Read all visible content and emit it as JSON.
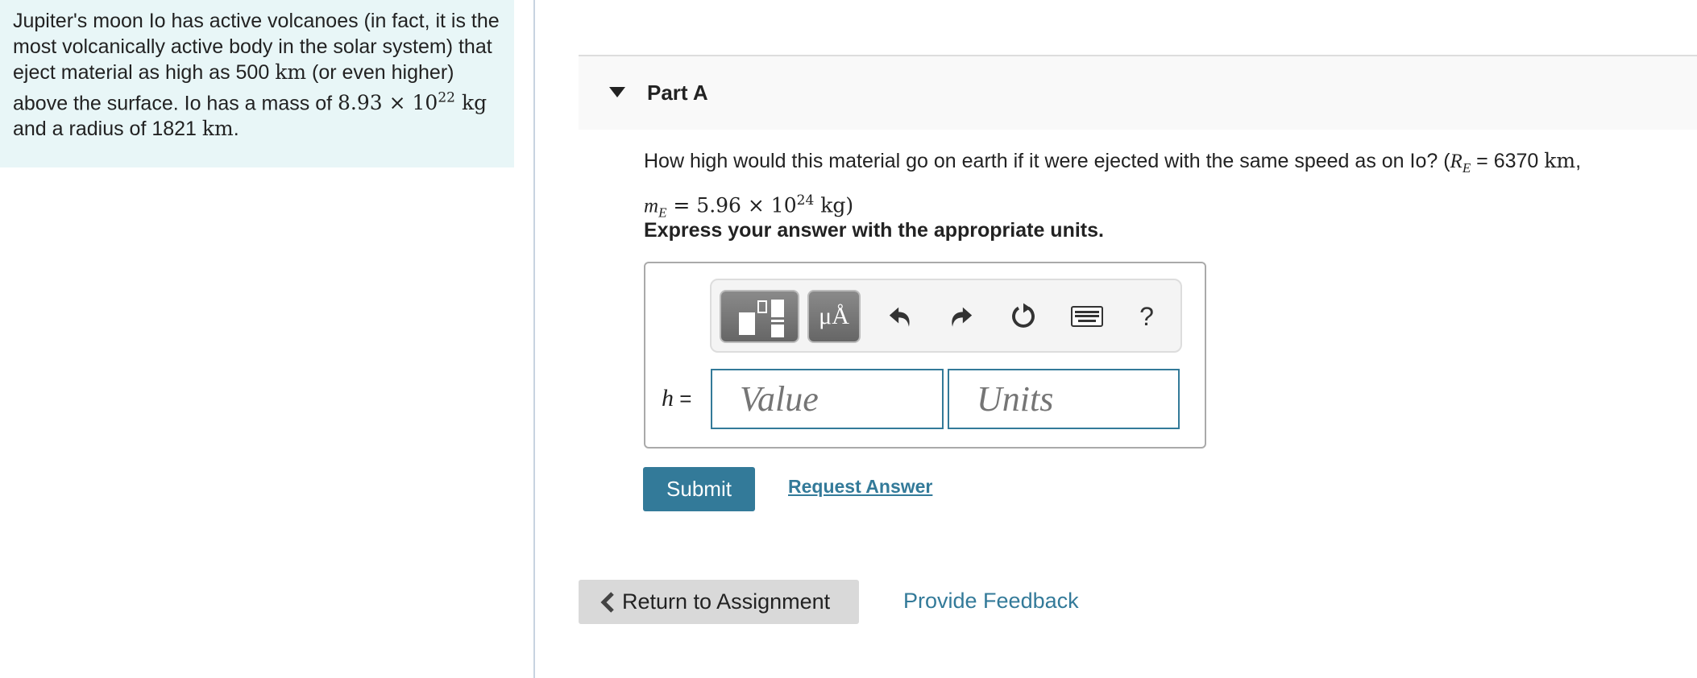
{
  "intro": {
    "text_1": "Jupiter's moon Io has active volcanoes (in fact, it is the most volcanically active body in the solar system) that eject material as high as 500 ",
    "unit_km": "km",
    "text_2": " (or even higher) above the surface. Io has a mass of ",
    "mass_mantissa": "8.93 × 10",
    "mass_exp": "22",
    "unit_kg": "kg",
    "text_3": " and a radius of 1821 ",
    "unit_km2": "km",
    "text_4": "."
  },
  "part": {
    "title": "Part A",
    "question_text": "How high would this material go on earth if it were ejected with the same speed as on Io? (",
    "re_symbol": "R",
    "re_sub": "E",
    "re_value": " = 6370 ",
    "re_unit": "km",
    "comma": ",",
    "me_symbol": "m",
    "me_sub": "E",
    "me_value": " = 5.96 × 10",
    "me_exp": "24",
    "me_unit": " kg)",
    "instruction": "Express your answer with the appropriate units."
  },
  "answer": {
    "variable": "h",
    "equals": " =",
    "value_placeholder": "Value",
    "units_placeholder": "Units",
    "units_button_label": "μÅ",
    "help_label": "?",
    "toolbar_icons": [
      "templates-icon",
      "units-icon",
      "undo-icon",
      "redo-icon",
      "reset-icon",
      "keyboard-icon",
      "help-icon"
    ]
  },
  "actions": {
    "submit": "Submit",
    "request_answer": "Request Answer",
    "return": "Return to Assignment",
    "feedback": "Provide Feedback"
  },
  "colors": {
    "accent": "#337a99",
    "intro_bg": "#e8f6f7"
  }
}
